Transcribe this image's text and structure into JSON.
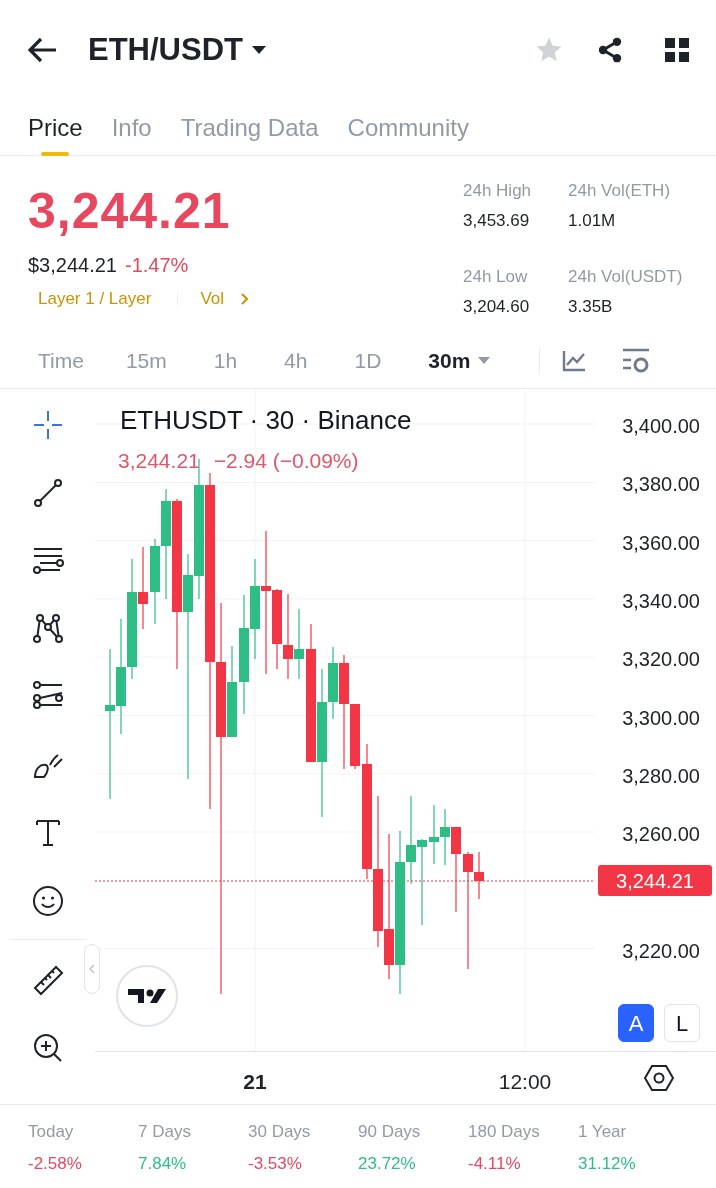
{
  "header": {
    "pair": "ETH/USDT",
    "favorite": false
  },
  "tabs": [
    {
      "label": "Price",
      "selected": true
    },
    {
      "label": "Info",
      "selected": false
    },
    {
      "label": "Trading Data",
      "selected": false
    },
    {
      "label": "Community",
      "selected": false
    }
  ],
  "ticker": {
    "last_price": "3,244.21",
    "usd_price": "$3,244.21",
    "change": "-1.47%",
    "color": "#e8485f",
    "tags": [
      "Layer 1 / Layer",
      "Vol"
    ],
    "stats": [
      {
        "label": "24h High",
        "value": "3,453.69"
      },
      {
        "label": "24h Vol(ETH)",
        "value": "1.01M"
      },
      {
        "label": "24h Low",
        "value": "3,204.60"
      },
      {
        "label": "24h Vol(USDT)",
        "value": "3.35B"
      }
    ]
  },
  "intervals": [
    {
      "label": "Time",
      "selected": false,
      "dropdown": false
    },
    {
      "label": "15m",
      "selected": false,
      "dropdown": false
    },
    {
      "label": "1h",
      "selected": false,
      "dropdown": false
    },
    {
      "label": "4h",
      "selected": false,
      "dropdown": false
    },
    {
      "label": "1D",
      "selected": false,
      "dropdown": false
    },
    {
      "label": "30m",
      "selected": true,
      "dropdown": true
    }
  ],
  "chart": {
    "title": "ETHUSDT · 30 · Binance",
    "last": "3,244.21",
    "change": "−2.94 (−0.09%)",
    "price_axis": [
      "3,400.00",
      "3,380.00",
      "3,360.00",
      "3,340.00",
      "3,320.00",
      "3,300.00",
      "3,280.00",
      "3,260.00",
      "3,220.00"
    ],
    "current_price": "3,244.21",
    "time_axis": [
      "21",
      "12:00"
    ],
    "scale_buttons": [
      {
        "label": "A",
        "selected": true
      },
      {
        "label": "L",
        "selected": false
      }
    ]
  },
  "performance": [
    {
      "period": "Today",
      "change": "-2.58%",
      "color": "#e8485f"
    },
    {
      "period": "7 Days",
      "change": "7.84%",
      "color": "#2ebd85"
    },
    {
      "period": "30 Days",
      "change": "-3.53%",
      "color": "#e8485f"
    },
    {
      "period": "90 Days",
      "change": "23.72%",
      "color": "#2ebd85"
    },
    {
      "period": "180 Days",
      "change": "-4.11%",
      "color": "#e8485f"
    },
    {
      "period": "1 Year",
      "change": "31.12%",
      "color": "#2ebd85"
    }
  ]
}
